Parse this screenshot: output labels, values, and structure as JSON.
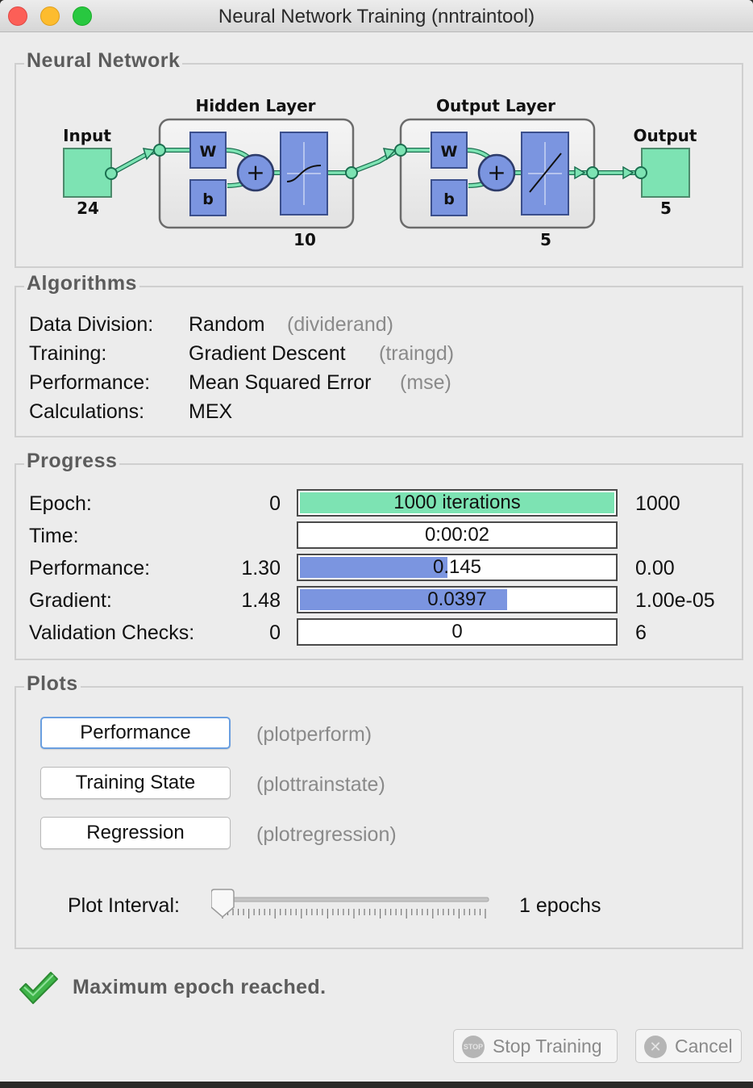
{
  "window": {
    "title": "Neural Network Training (nntraintool)"
  },
  "network": {
    "section_title": "Neural Network",
    "input_label": "Input",
    "input_size": "24",
    "hidden_label": "Hidden Layer",
    "hidden_size": "10",
    "output_layer_label": "Output Layer",
    "output_layer_size": "5",
    "output_label": "Output",
    "output_size": "5",
    "weight_label": "W",
    "bias_label": "b",
    "sum_symbol": "+"
  },
  "algorithms": {
    "section_title": "Algorithms",
    "rows": [
      {
        "label": "Data Division:",
        "value": "Random",
        "func": "(dividerand)"
      },
      {
        "label": "Training:",
        "value": "Gradient Descent",
        "func": "(traingd)"
      },
      {
        "label": "Performance:",
        "value": "Mean Squared Error",
        "func": "(mse)"
      },
      {
        "label": "Calculations:",
        "value": "MEX",
        "func": ""
      }
    ]
  },
  "progress": {
    "section_title": "Progress",
    "rows": [
      {
        "label": "Epoch:",
        "start": "0",
        "current": "1000 iterations",
        "end": "1000",
        "fill": 1.0,
        "fill_color": "#7de3b3"
      },
      {
        "label": "Time:",
        "start": "",
        "current": "0:00:02",
        "end": "",
        "fill": 0.0,
        "fill_color": "#7b95e0"
      },
      {
        "label": "Performance:",
        "start": "1.30",
        "current": "0.145",
        "end": "0.00",
        "fill": 0.47,
        "fill_color": "#7b95e0"
      },
      {
        "label": "Gradient:",
        "start": "1.48",
        "current": "0.0397",
        "end": "1.00e-05",
        "fill": 0.66,
        "fill_color": "#7b95e0"
      },
      {
        "label": "Validation Checks:",
        "start": "0",
        "current": "0",
        "end": "6",
        "fill": 0.0,
        "fill_color": "#7b95e0"
      }
    ]
  },
  "plots": {
    "section_title": "Plots",
    "buttons": [
      {
        "label": "Performance",
        "func": "(plotperform)"
      },
      {
        "label": "Training State",
        "func": "(plottrainstate)"
      },
      {
        "label": "Regression",
        "func": "(plotregression)"
      }
    ],
    "interval_label": "Plot Interval:",
    "interval_value": "1 epochs",
    "slider_position": 0.0
  },
  "status": {
    "message": "Maximum epoch reached."
  },
  "footer": {
    "stop_label": "Stop Training",
    "stop_icon_text": "STOP",
    "cancel_label": "Cancel"
  },
  "colors": {
    "accent_green": "#7de3b3",
    "accent_blue": "#7b95e0",
    "check_green": "#3fb449"
  }
}
